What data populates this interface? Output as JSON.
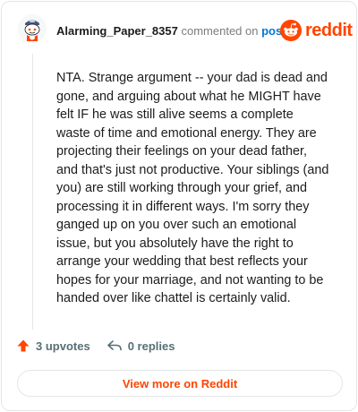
{
  "comment": {
    "username": "Alarming_Paper_8357",
    "action_text": "commented on",
    "post_link_text": "post",
    "body": "NTA. Strange argument -- your dad is dead and gone, and arguing about what he MIGHT have felt IF he was still alive seems a complete waste of time and emotional energy. They are projecting their feelings on your dead father, and that's just not productive. Your siblings (and you) are still working through your grief, and processing it in different ways. I'm sorry they ganged up on you over such an emotional issue, but you absolutely have the right to arrange your wedding that best reflects your hopes for your marriage, and not wanting to be handed over like chattel is certainly valid."
  },
  "brand": {
    "logo_text": "reddit",
    "accent_color": "#ff4500",
    "link_color": "#0079d3"
  },
  "footer": {
    "upvotes_label": "3 upvotes",
    "replies_label": "0 replies",
    "upvote_icon": "upvote-arrow-icon",
    "reply_icon": "reply-arrow-icon"
  },
  "view_more": {
    "label": "View more on Reddit"
  }
}
